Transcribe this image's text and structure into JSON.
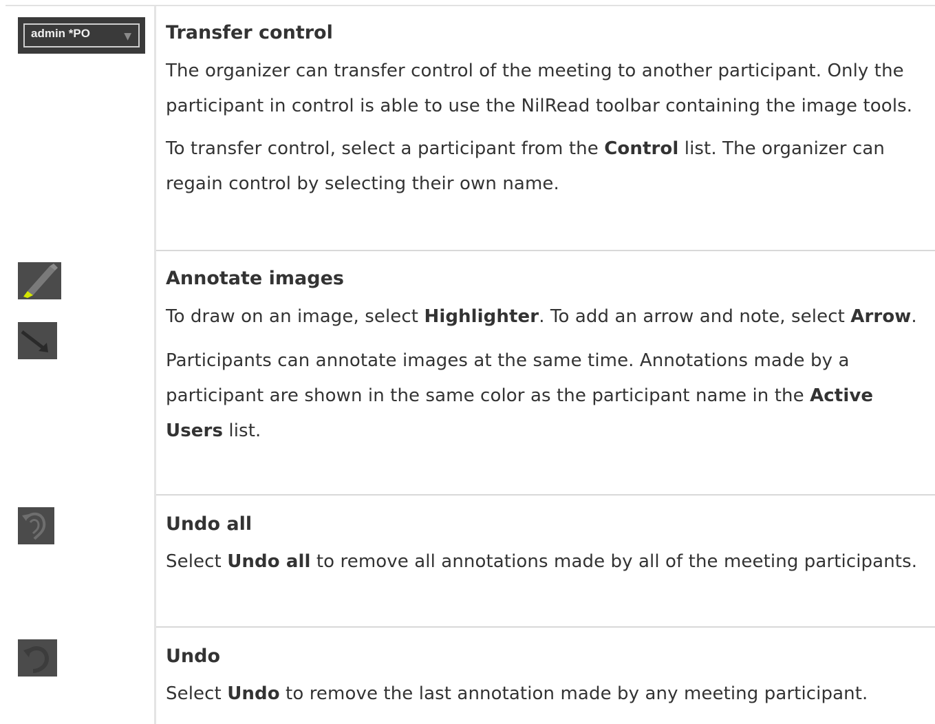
{
  "rows": [
    {
      "title": "Transfer control",
      "icon_control": {
        "text": "admin *PO"
      },
      "p1": "The organizer can transfer control of the meeting to another participant. Only the participant in control is able to use the NilRead toolbar containing the image tools.",
      "p2_a": "To transfer control, select a participant from the ",
      "p2_b": "Control",
      "p2_c": " list. The organizer can regain control by selecting their own name."
    },
    {
      "title": "Annotate images",
      "icons": [
        "highlighter-icon",
        "arrow-icon"
      ],
      "p1_a": "To draw on an image, select ",
      "p1_b": "Highlighter",
      "p1_c": ". To add an arrow and note, select ",
      "p1_d": "Arrow",
      "p1_e": ".",
      "p2_a": "Participants can annotate images at the same time. Annotations made by a participant are shown in the same color as the participant name in the ",
      "p2_b": "Active Users",
      "p2_c": " list."
    },
    {
      "title": "Undo all",
      "icon": "undo-all-icon",
      "p1_a": "Select ",
      "p1_b": "Undo all",
      "p1_c": " to remove all annotations made by all of the meeting participants."
    },
    {
      "title": "Undo",
      "icon": "undo-icon",
      "p1_a": "Select ",
      "p1_b": "Undo",
      "p1_c": " to remove the last annotation made by any meeting participant."
    }
  ],
  "colors": {
    "icon_bg": "#4b4b4b",
    "highlighter_tip": "#d4e600",
    "text": "#333333"
  }
}
